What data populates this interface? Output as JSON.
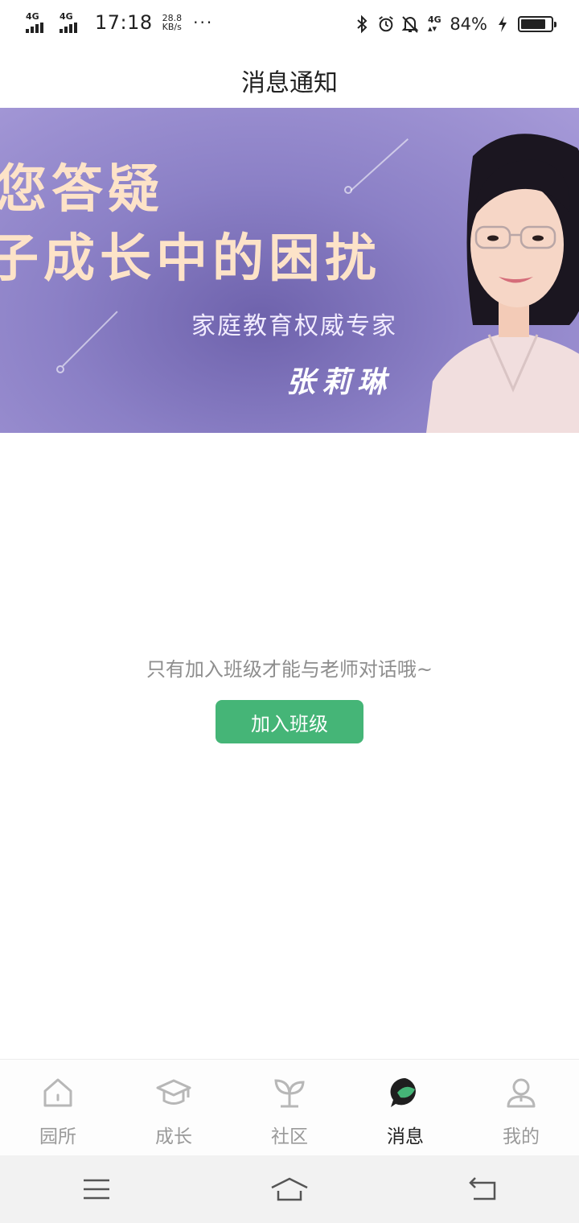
{
  "status_bar": {
    "network1": "4G",
    "network2": "4G",
    "time": "17:18",
    "speed_value": "28.8",
    "speed_unit": "KB/s",
    "more": "···",
    "battery_pct": "84%",
    "battery_level": 0.84,
    "icons": [
      "bluetooth-icon",
      "alarm-icon",
      "mute-icon",
      "network-icon",
      "charging-icon"
    ]
  },
  "header": {
    "title": "消息通知"
  },
  "banner": {
    "line1": "您答疑",
    "line2": "子成长中的困扰",
    "subtitle": "家庭教育权威专家",
    "name": "张莉琳"
  },
  "empty_state": {
    "message": "只有加入班级才能与老师对话哦~",
    "button_label": "加入班级"
  },
  "tabbar": {
    "items": [
      {
        "label": "园所",
        "icon": "house-icon",
        "active": false
      },
      {
        "label": "成长",
        "icon": "graduation-cap-icon",
        "active": false
      },
      {
        "label": "社区",
        "icon": "sprout-icon",
        "active": false
      },
      {
        "label": "消息",
        "icon": "chat-bubble-icon",
        "active": true
      },
      {
        "label": "我的",
        "icon": "person-icon",
        "active": false
      }
    ]
  },
  "colors": {
    "accent": "#45b577",
    "banner": "#8b80c6",
    "inactive_tab": "#9a9a9a"
  }
}
